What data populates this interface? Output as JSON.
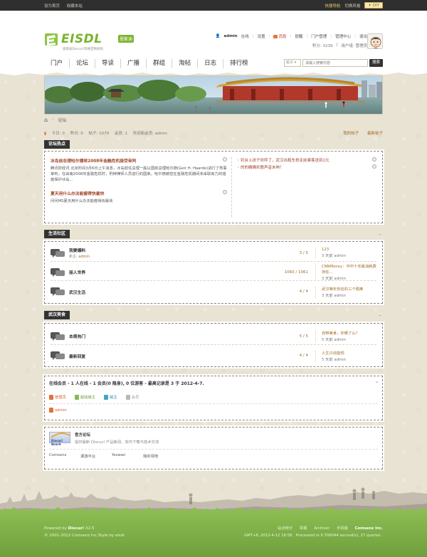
{
  "topbar": {
    "set_home": "设为首页",
    "bookmark": "收藏本站",
    "quick_nav": "快捷导航",
    "switch_style": "切换风格",
    "diy": "DIY"
  },
  "header": {
    "logo_text": "EISDL",
    "logo_cn": "恩斯迪",
    "logo_slogan": "恩斯迪Discuz!风格定制机构",
    "user": {
      "name": "admin",
      "online": "在线",
      "settings": "设置",
      "messages": "消息",
      "reminders": "提醒",
      "portal_admin": "门户管理",
      "admin_center": "管理中心",
      "logout": "退出",
      "points": "积分: 3239",
      "group": "用户组: 管理员"
    },
    "nav": [
      "门户",
      "论坛",
      "导读",
      "广播",
      "群组",
      "淘帖",
      "日志",
      "排行榜"
    ],
    "search": {
      "scope": "帖子",
      "placeholder": "请输入搜索内容",
      "button": "搜索"
    }
  },
  "breadcrumb": {
    "current": "论坛"
  },
  "stats": {
    "today": "今日: 0",
    "yesterday": "昨日: 0",
    "posts": "帖子: 1079",
    "members": "会员: 1",
    "newest": "欢迎新会员: admin",
    "my_posts": "我的帖子",
    "new_posts": "最新帖子"
  },
  "hot": {
    "title": "论坛热点",
    "left": [
      {
        "title": "冰岛前总理哈尔德将2008年金融危机接受审判",
        "text": "腾讯财经讯 北京时间3月6日上午消息，冰岛前任总理一般以国前总理哈尔德(Geir H. Haarde)进行了刑事审判，在由南2008年金融危机时，刑辩律师人员进行的国家。哈尔德被控在金融危机期间未采取有力的措施保护冰岛..."
      },
      {
        "title": "夏天用什么办法能瘦得快最快",
        "text": "问问MS夏天用什么办法能瘦得快最快"
      }
    ],
    "right": [
      "钓台上孩子欢呼了，武汉出租车抢走前乘客送到2元",
      "的的确确欢歌声音未响！"
    ]
  },
  "sections": [
    {
      "title": "生活社区",
      "forums": [
        {
          "name": "我要爆料",
          "sub": "新主: ",
          "sub_link": "admin",
          "count": "3 / 5",
          "last_title": "123",
          "last_meta": "3 天前 admin"
        },
        {
          "name": "丽人世界",
          "sub": "",
          "sub_link": "",
          "count": "1060 / 1061",
          "last_title": "CNNMoney：中中十年最消耗费持任...",
          "last_meta": "3 天前 admin"
        },
        {
          "name": "武汉生活",
          "sub": "",
          "sub_link": "",
          "count": "4 / 4",
          "last_title": "武汉等年你召的三个隔离",
          "last_meta": "3 天前 admin"
        }
      ]
    },
    {
      "title": "武汉美食",
      "forums": [
        {
          "name": "本周热门",
          "sub": "",
          "sub_link": "",
          "count": "5 / 5",
          "last_title": "自带美食，你哪了么？",
          "last_meta": "5 天前 admin"
        },
        {
          "name": "最新回复",
          "sub": "",
          "sub_link": "",
          "count": "4 / 4",
          "last_title": "人生只动能现",
          "last_meta": "5 天前 admin"
        }
      ]
    }
  ],
  "online": {
    "title": "在线会员 - 1 人在线 - 1 会员(0 隐身), 0 位游客 - 最高记录是 3 于 2012-4-7.",
    "legend": [
      "管理员",
      "超级版主",
      "版主",
      "会员"
    ],
    "users": [
      "admin"
    ]
  },
  "links": {
    "logo_text": "Discuz! Board",
    "title": "官方论坛",
    "desc": "提供最新 Discuz! 产品新闻、软件下载与技术交流",
    "items": [
      "Comsenz",
      "漫游平台",
      "Yeswan",
      "我的领地"
    ]
  },
  "footer": {
    "powered": "Powered by",
    "product": "Discuz!",
    "version": "X2.5",
    "copyright": "© 2001-2012 Comsenz Inc.Style by eisdl",
    "links": [
      "站点统计",
      "举报",
      "Archiver",
      "手机版"
    ],
    "company": "Comsenz Inc.",
    "time": "GMT+8, 2012-4-12 16:58 , Processed in 0.706044 second(s), 27 queries ."
  },
  "colors": {
    "accent_green": "#7bb32e",
    "link_brown": "#a06c20",
    "hot_red": "#a0452a",
    "dark": "#333333"
  }
}
